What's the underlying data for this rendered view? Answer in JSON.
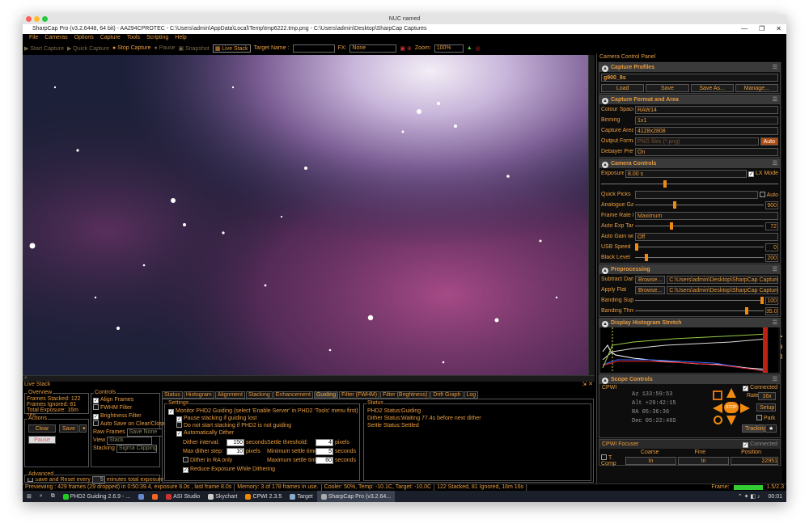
{
  "os_title": "NUC named",
  "window_title": "SharpCap Pro (v3.2.6448, 64 bit) - AA294CPROTEC - C:\\Users\\admin\\AppData\\Local\\Temp\\tmp6222.tmp.png - C:\\Users\\admin\\Desktop\\SharpCap Captures",
  "menu": [
    "File",
    "Cameras",
    "Options",
    "Capture",
    "Tools",
    "Scripting",
    "Help"
  ],
  "toolbar": {
    "start_capture": "Start Capture",
    "quick_capture": "Quick Capture",
    "stop_capture": "Stop Capture",
    "pause": "Pause",
    "snapshot": "Snapshot",
    "live_stack": "Live Stack",
    "target_label": "Target Name :",
    "target_value": "",
    "fx_label": "FX:",
    "fx_value": "None",
    "zoom_label": "Zoom:",
    "zoom_value": "100%"
  },
  "panel": {
    "title": "Camera Control Panel",
    "capture_profiles": {
      "title": "Capture Profiles",
      "profile": "g900_8s",
      "buttons": [
        "Load",
        "Save",
        "Save As...",
        "Manage..."
      ]
    },
    "format": {
      "title": "Capture Format and Area",
      "colour_space_label": "Colour Space",
      "colour_space": "RAW14",
      "binning_label": "Binning",
      "binning": "1x1",
      "area_label": "Capture Area",
      "area": "4128x2808",
      "output_label": "Output Format",
      "output": "PNG files (*.png)",
      "auto": "Auto",
      "debayer_label": "Debayer Preview",
      "debayer": "On"
    },
    "controls": {
      "title": "Camera Controls",
      "exposure_label": "Exposure",
      "exposure": "8.00 s",
      "lx_mode": "LX Mode",
      "quick_picks": "Quick Picks",
      "auto": "Auto",
      "gain_label": "Analogue Gain",
      "gain": "900",
      "gain_level": 0.3,
      "frame_rate_label": "Frame Rate Limit",
      "frame_rate": "Maximum",
      "auto_exp_label": "Auto Exp Target",
      "auto_exp": "72",
      "auto_exp_level": 0.28,
      "auto_gain_label": "Auto Gain with Auto Exposure",
      "auto_gain": "Off",
      "usb_label": "USB Speed",
      "usb": "0",
      "usb_level": 0.0,
      "black_label": "Black Level",
      "black": "200",
      "black_level": 0.08
    },
    "preprocessing": {
      "title": "Preprocessing",
      "dark_label": "Subtract Dark",
      "dark": "C:\\Users\\admin\\Desktop\\SharpCap Captures\\darks\\AA29...",
      "flat_label": "Apply Flat",
      "flat": "C:\\Users\\admin\\Desktop\\SharpCap Captures\\2020-11-12...",
      "browse": "Browse...",
      "banding_label": "Banding Suppression",
      "banding": "100",
      "banding_level": 1.0,
      "threshold_label": "Banding Threshold",
      "threshold": "35.0",
      "threshold_level": 0.88
    },
    "histogram": {
      "title": "Display Histogram Stretch"
    },
    "scope": {
      "title": "Scope Controls",
      "driver": "CPWI",
      "connected": "Connected",
      "az": "Az  133:59:53",
      "alt": "Alt +29:42:15",
      "ra": "RA  05:36:36",
      "dec": "Dec 05:22:46S",
      "rate_label": "Rate",
      "rate": "16x",
      "setup": "Setup",
      "park": "Park",
      "tracking": "Tracking",
      "stop": "STOP"
    },
    "focuser": {
      "title": "CPWI Focuser",
      "connected": "Connected",
      "coarse": "Coarse",
      "fine": "Fine",
      "position": "Position",
      "in": "In",
      "pos_value": "22951",
      "tcomp": "T. Comp"
    }
  },
  "live_stack": {
    "title": "Live Stack",
    "overview": {
      "title": "Overview",
      "stacked": "Frames Stacked: 122",
      "ignored": "Frames Ignored: 81",
      "total": "Total Exposure: 16m 16s"
    },
    "actions": {
      "title": "Actions",
      "clear": "Clear",
      "save": "Save",
      "pause": "Pause"
    },
    "advanced": {
      "title": "Advanced",
      "save_reset": "Save and Reset every",
      "minutes": "5",
      "minutes_label": "minutes total exposure"
    },
    "controls": {
      "title": "Controls",
      "align": "Align Frames",
      "fwhm": "FWHM Filter",
      "brightness": "Brightness Filter",
      "autosave": "Auto Save on Clear/Close",
      "raw_label": "Raw Frames",
      "raw": "Save None",
      "view_label": "View",
      "view": "Stack",
      "stacking_label": "Stacking",
      "stacking": "Sigma Clipping"
    },
    "tabs": [
      "Status",
      "Histogram",
      "Alignment",
      "Stacking",
      "Enhancement",
      "Guiding",
      "Filter (FWHM)",
      "Filter (Brightness)",
      "Drift Graph",
      "Log"
    ],
    "active_tab": "Guiding",
    "settings": {
      "title": "Settings",
      "monitor": "Monitor PHD2 Guiding (select 'Enable Server' in PHD2 'Tools' menu first)",
      "pause_lost": "Pause stacking if guiding lost",
      "no_start": "Do not start stacking if PHD2 is not guiding",
      "auto_dither": "Automatically Dither",
      "dither_interval_label": "Dither interval:",
      "dither_interval": "150",
      "seconds": "seconds",
      "max_step_label": "Max dither step:",
      "max_step": "10",
      "pixels": "pixels",
      "ra_only": "Dither in RA only",
      "reduce": "Reduce Exposure While Dithering",
      "settle_threshold_label": "Settle threshold:",
      "settle_threshold": "4",
      "min_settle_label": "Minimum settle time:",
      "min_settle": "5",
      "max_settle_label": "Maximum settle time:",
      "max_settle": "60"
    },
    "status": {
      "title": "Status",
      "phd2_label": "PHD2 Status:",
      "phd2": "Guiding",
      "dither_label": "Dither Status:",
      "dither": "Waiting 77.4s before next dither",
      "settle_label": "Settle Status:",
      "settle": "Settled"
    }
  },
  "statusbar": [
    "Previewing : 429 frames (29 dropped) in 0:50:39.4, exposure 8.0s , last frame 8.0s",
    "Memory: 3 of 178 frames in use.",
    "Cooler: 50%, Temp: -10.1C, Target: -10.0C",
    "122 Stacked, 81 Ignored, 16m 16s"
  ],
  "frame_label": "Frame:",
  "frame_value": "1.5/2.3",
  "taskbar": [
    "PHD2 Guiding 2.6.9 - ...",
    "ASI Studio",
    "Skychart",
    "CPWI 2.3.5",
    "Target",
    "SharpCap Pro (v3.2.64..."
  ],
  "clock": "00:01"
}
